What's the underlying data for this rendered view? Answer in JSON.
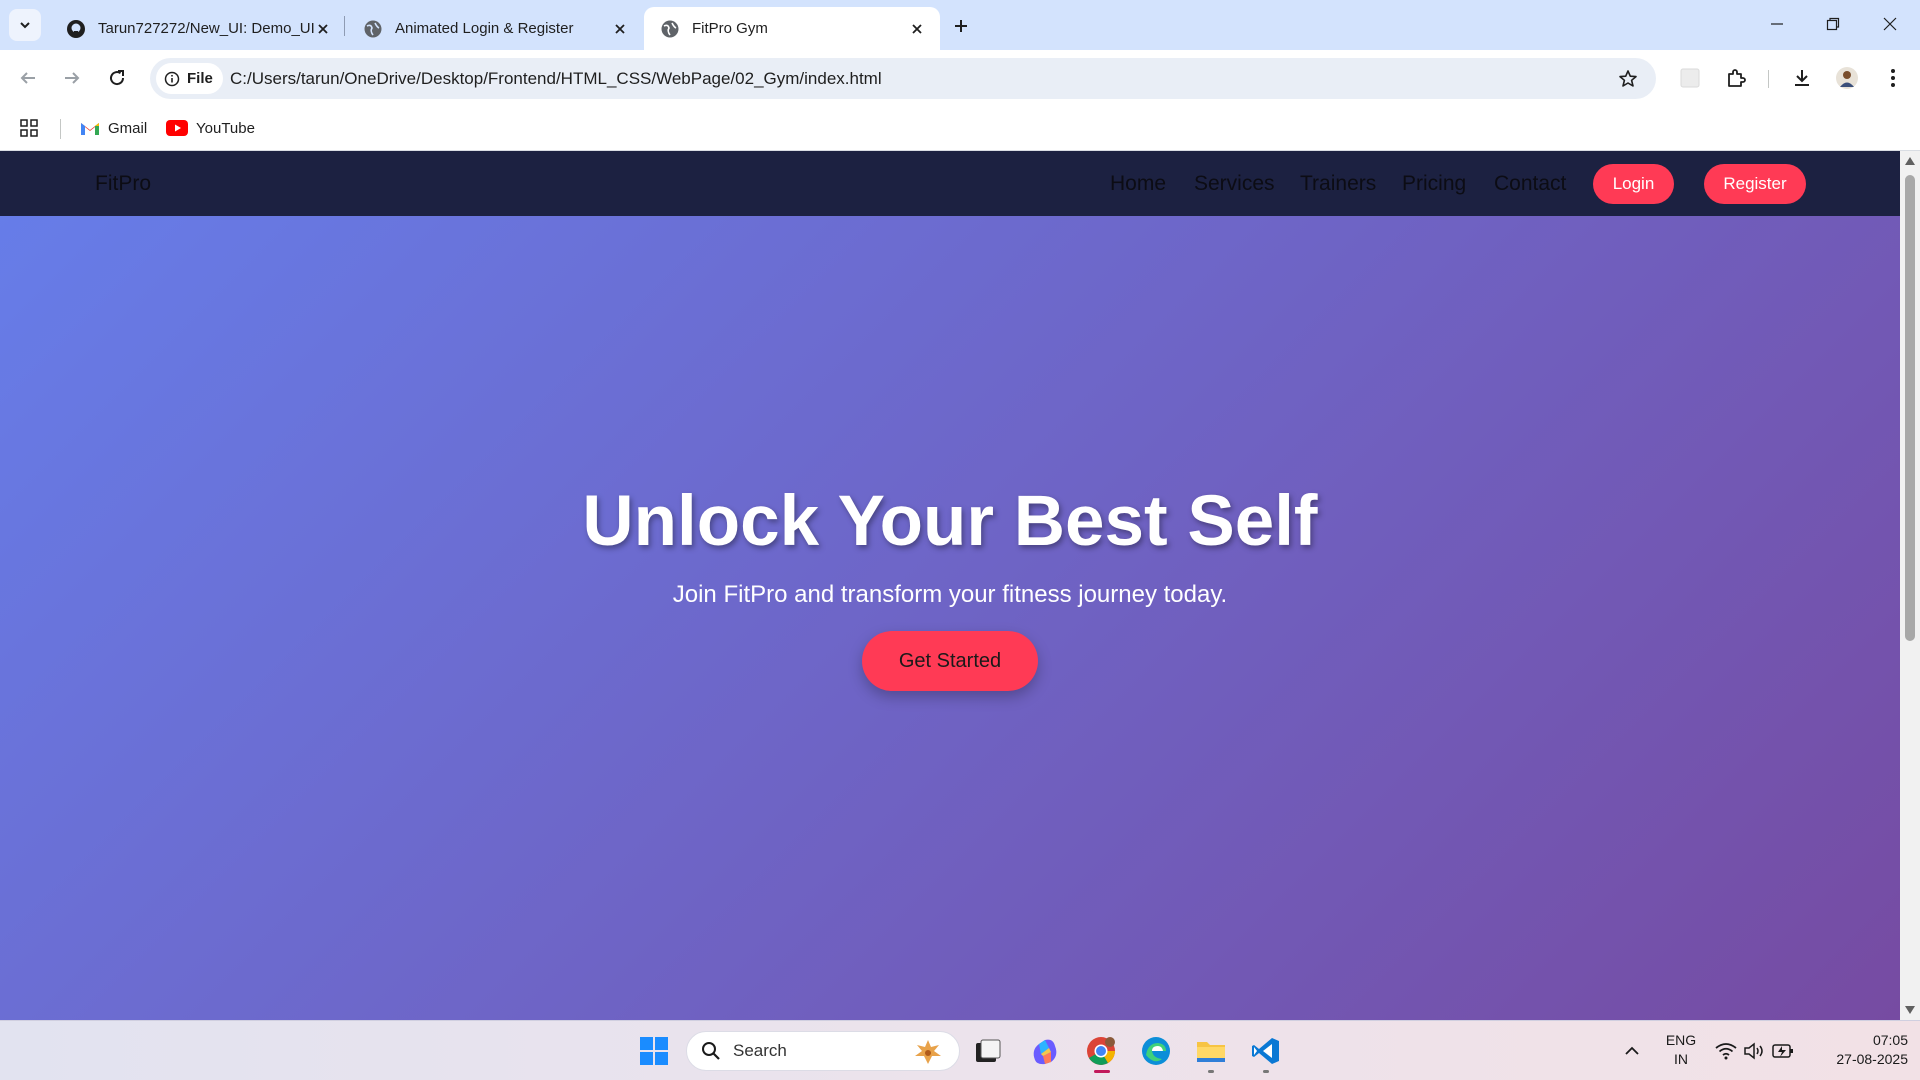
{
  "browser": {
    "tabs": [
      {
        "title": "Tarun727272/New_UI: Demo_UI",
        "icon": "github-icon",
        "active": false
      },
      {
        "title": "Animated Login & Register",
        "icon": "globe-icon",
        "active": false
      },
      {
        "title": "FitPro Gym",
        "icon": "globe-icon",
        "active": true
      }
    ],
    "file_chip": "File",
    "url": "C:/Users/tarun/OneDrive/Desktop/Frontend/HTML_CSS/WebPage/02_Gym/index.html",
    "bookmarks": [
      {
        "label": "Gmail",
        "icon": "gmail-icon"
      },
      {
        "label": "YouTube",
        "icon": "youtube-icon"
      }
    ]
  },
  "site": {
    "logo": "FitPro",
    "nav": [
      "Home",
      "Services",
      "Trainers",
      "Pricing",
      "Contact"
    ],
    "login_label": "Login",
    "register_label": "Register",
    "hero": {
      "title": "Unlock Your Best Self",
      "subtitle": "Join FitPro and transform your fitness journey today.",
      "cta": "Get Started"
    },
    "colors": {
      "accent": "#ff3a55",
      "nav_bg": "#1c2141",
      "gradient_start": "#667eea",
      "gradient_end": "#764ba2"
    }
  },
  "taskbar": {
    "search_label": "Search",
    "language": "ENG",
    "region": "IN",
    "time": "07:05",
    "date": "27-08-2025"
  }
}
